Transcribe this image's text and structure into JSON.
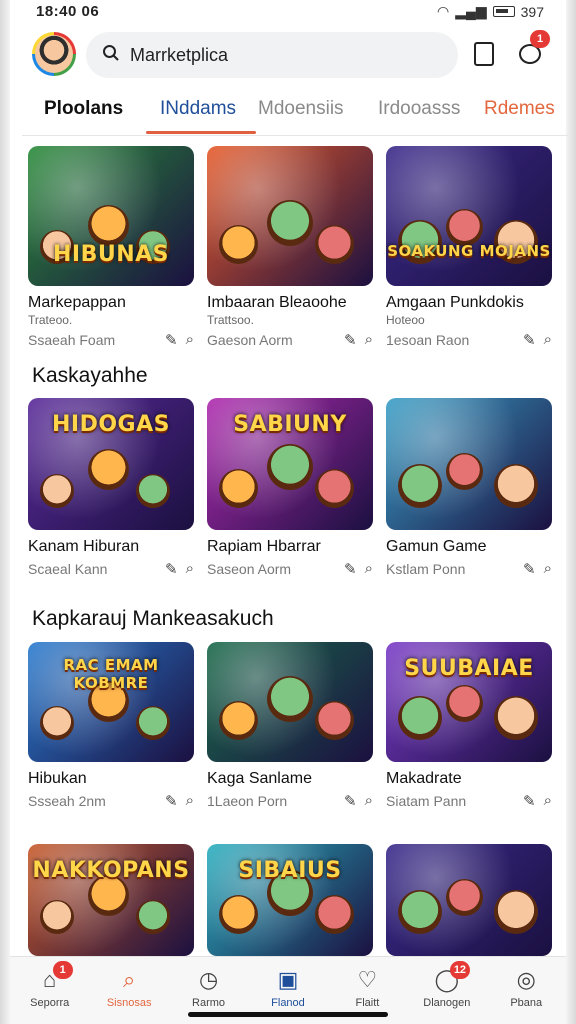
{
  "status": {
    "time": "18:40 06",
    "right": "397"
  },
  "search": {
    "placeholder": "Marrketplica"
  },
  "header": {
    "chat_badge": "1"
  },
  "tabs": [
    {
      "label": "Ploolans",
      "color": "#111111"
    },
    {
      "label": "INddams",
      "color": "#1f4f9a"
    },
    {
      "label": "Mdoensiis",
      "color": "#8a8a8a"
    },
    {
      "label": "Irdooasss",
      "color": "#8a8a8a"
    },
    {
      "label": "Rdemes",
      "color": "#e2673e"
    }
  ],
  "sections": [
    {
      "title": "",
      "cards": [
        {
          "title": "Markepappan",
          "sub": "Trateoo.",
          "meta": "Ssaeah Foam",
          "art": "HIBUNAS",
          "bg": "#2a8c3a"
        },
        {
          "title": "Imbaaran Bleaoohe",
          "sub": "Trattsoo.",
          "meta": "Gaeson Aorm",
          "art": "",
          "bg": "#e85b2a"
        },
        {
          "title": "Amgaan Punkdokis",
          "sub": "Hoteoo",
          "meta": "1esoan Raon",
          "art": "SOAKUNG MOJANS",
          "bg": "#3c2a8c"
        }
      ]
    },
    {
      "title": "Kaskayahhe",
      "cards": [
        {
          "title": "Kanam Hiburan",
          "sub": "",
          "meta": "Scaeal Kann",
          "art": "HIDOGAS",
          "bg": "#5a2a9a"
        },
        {
          "title": "Rapiam Hbarrar",
          "sub": "",
          "meta": "Saseon Aorm",
          "art": "SABIUNY",
          "bg": "#b02ab0"
        },
        {
          "title": "Gamun Game",
          "sub": "",
          "meta": "Kstlam Ponn",
          "art": "",
          "bg": "#3aa0c8"
        }
      ]
    },
    {
      "title": "Kapkarauj Mankeasakuch",
      "cards": [
        {
          "title": "Hibukan",
          "sub": "",
          "meta": "Ssseah 2nm",
          "art": "RAC EMAM KOBMRE",
          "bg": "#2a7cd0"
        },
        {
          "title": "Kaga Sanlame",
          "sub": "",
          "meta": "1Laeon Porn",
          "art": "",
          "bg": "#1a6a4a"
        },
        {
          "title": "Makadrate",
          "sub": "",
          "meta": "Siatam Pann",
          "art": "SUUBAIAE",
          "bg": "#7a3ac8"
        }
      ]
    },
    {
      "title": "",
      "cards": [
        {
          "title": "",
          "sub": "",
          "meta": "",
          "art": "NAKKOPANS",
          "bg": "#c85a2a"
        },
        {
          "title": "",
          "sub": "",
          "meta": "",
          "art": "SIBAIUS",
          "bg": "#2ab0c0"
        },
        {
          "title": "",
          "sub": "",
          "meta": "",
          "art": "",
          "bg": "#3a2a8c"
        }
      ]
    }
  ],
  "bottom_nav": [
    {
      "label": "Seporra",
      "icon": "home-icon",
      "badge": "1",
      "color": "#444444"
    },
    {
      "label": "Sisnosas",
      "icon": "search-icon",
      "badge": "",
      "color": "#e2673e"
    },
    {
      "label": "Rarmo",
      "icon": "clock-icon",
      "badge": "",
      "color": "#444444"
    },
    {
      "label": "Flanod",
      "icon": "store-icon",
      "badge": "",
      "color": "#1f4f9a"
    },
    {
      "label": "Flaitt",
      "icon": "heart-icon",
      "badge": "",
      "color": "#444444"
    },
    {
      "label": "Dlanogen",
      "icon": "chat-icon",
      "badge": "12",
      "color": "#444444"
    },
    {
      "label": "Pbana",
      "icon": "profile-icon",
      "badge": "",
      "color": "#444444"
    }
  ]
}
